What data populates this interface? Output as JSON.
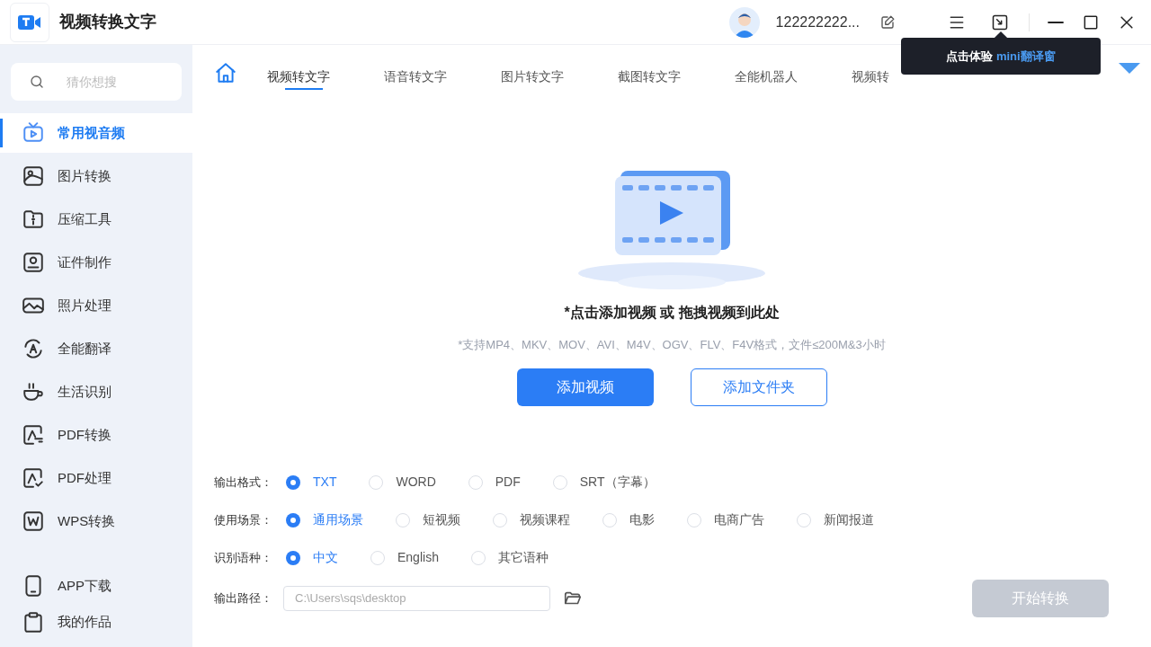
{
  "app": {
    "title": "视频转换文字"
  },
  "user": {
    "name": "122222222..."
  },
  "tooltip": {
    "text": "点击体验",
    "highlight": "mini翻译窗"
  },
  "search": {
    "placeholder": "猜你想搜"
  },
  "sidebar": {
    "items": [
      {
        "label": "常用视音频",
        "selected": true
      },
      {
        "label": "图片转换",
        "selected": false
      },
      {
        "label": "压缩工具",
        "selected": false
      },
      {
        "label": "证件制作",
        "selected": false
      },
      {
        "label": "照片处理",
        "selected": false
      },
      {
        "label": "全能翻译",
        "selected": false
      },
      {
        "label": "生活识别",
        "selected": false
      },
      {
        "label": "PDF转换",
        "selected": false
      },
      {
        "label": "PDF处理",
        "selected": false
      },
      {
        "label": "WPS转换",
        "selected": false
      }
    ],
    "bottom_items": [
      {
        "label": "APP下载"
      },
      {
        "label": "我的作品"
      }
    ]
  },
  "tabs": [
    {
      "label": "视频转文字",
      "selected": true
    },
    {
      "label": "语音转文字",
      "selected": false
    },
    {
      "label": "图片转文字",
      "selected": false
    },
    {
      "label": "截图转文字",
      "selected": false
    },
    {
      "label": "全能机器人",
      "selected": false
    },
    {
      "label": "视频转",
      "selected": false
    }
  ],
  "drop": {
    "title": "*点击添加视频 或 拖拽视频到此处",
    "hint": "*支持MP4、MKV、MOV、AVI、M4V、OGV、FLV、F4V格式，文件≤200M&3小时",
    "primary_button": "添加视频",
    "secondary_button": "添加文件夹"
  },
  "options": [
    {
      "label": "输出格式：",
      "choices": [
        {
          "label": "TXT",
          "selected": true
        },
        {
          "label": "WORD",
          "selected": false
        },
        {
          "label": "PDF",
          "selected": false
        },
        {
          "label": "SRT（字幕）",
          "selected": false
        }
      ]
    },
    {
      "label": "使用场景：",
      "choices": [
        {
          "label": "通用场景",
          "selected": true
        },
        {
          "label": "短视频",
          "selected": false
        },
        {
          "label": "视频课程",
          "selected": false
        },
        {
          "label": "电影",
          "selected": false
        },
        {
          "label": "电商广告",
          "selected": false
        },
        {
          "label": "新闻报道",
          "selected": false
        }
      ]
    },
    {
      "label": "识别语种：",
      "choices": [
        {
          "label": "中文",
          "selected": true
        },
        {
          "label": "English",
          "selected": false
        },
        {
          "label": "其它语种",
          "selected": false
        }
      ]
    }
  ],
  "output_path": {
    "label": "输出路径：",
    "placeholder": "C:\\Users\\sqs\\desktop"
  },
  "start_button": {
    "label": "开始转换",
    "disabled": true
  }
}
